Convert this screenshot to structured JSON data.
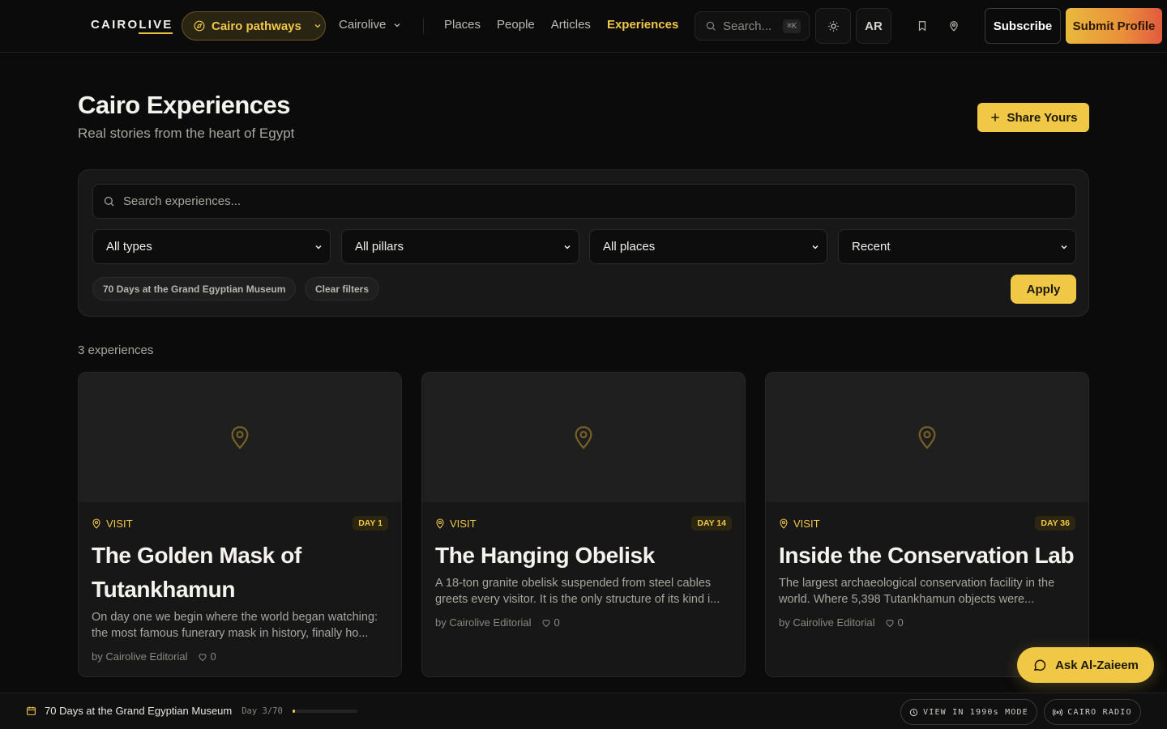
{
  "nav": {
    "logo_a": "CAIRO",
    "logo_b": "LIVE",
    "pathways_label": "Cairo pathways",
    "site_menu_label": "Cairolive",
    "links": [
      "Places",
      "People",
      "Articles",
      "Experiences"
    ],
    "active_link": "Experiences",
    "search_placeholder": "Search...",
    "search_shortcut": "⌘K",
    "lang_label": "AR",
    "subscribe_label": "Subscribe",
    "submit_label": "Submit Profile"
  },
  "header": {
    "title": "Cairo Experiences",
    "subtitle": "Real stories from the heart of Egypt",
    "share_label": "Share Yours"
  },
  "filters": {
    "search_placeholder": "Search experiences...",
    "type_select": "All types",
    "pillar_select": "All pillars",
    "place_select": "All places",
    "sort_select": "Recent",
    "active_chip": "70 Days at the Grand Egyptian Museum",
    "clear_label": "Clear filters",
    "apply_label": "Apply"
  },
  "results_count": "3 experiences",
  "cards": [
    {
      "type": "VISIT",
      "day": "DAY 1",
      "title": "The Golden Mask of Tutankhamun",
      "excerpt": "On day one we begin where the world began watching: the most famous funerary mask in history, finally ho...",
      "author": "by Cairolive Editorial",
      "likes": "0"
    },
    {
      "type": "VISIT",
      "day": "DAY 14",
      "title": "The Hanging Obelisk",
      "excerpt": "A 18-ton granite obelisk suspended from steel cables greets every visitor. It is the only structure of its kind i...",
      "author": "by Cairolive Editorial",
      "likes": "0"
    },
    {
      "type": "VISIT",
      "day": "DAY 36",
      "title": "Inside the Conservation Lab",
      "excerpt": "The largest archaeological conservation facility in the world. Where 5,398 Tutankhamun objects were...",
      "author": "by Cairolive Editorial",
      "likes": "0"
    }
  ],
  "assistant": {
    "label": "Ask Al-Zaieem"
  },
  "bottom_bar": {
    "series_title": "70 Days at the Grand Egyptian Museum",
    "day_label": "Day 3/70",
    "progress_fraction": 0.043,
    "mode_label": "VIEW IN 1990s MODE",
    "radio_label": "CAIRO RADIO"
  },
  "colors": {
    "accent": "#f0c845",
    "background": "#0b0b0b",
    "card": "#171717",
    "gradient_end": "#e25a3f"
  },
  "icons": [
    "compass-icon",
    "chevron-down-icon",
    "search-icon",
    "sun-icon",
    "bookmark-icon",
    "map-pin-icon",
    "plus-icon",
    "chat-icon",
    "heart-icon",
    "calendar-icon",
    "clock-icon",
    "radio-icon"
  ]
}
